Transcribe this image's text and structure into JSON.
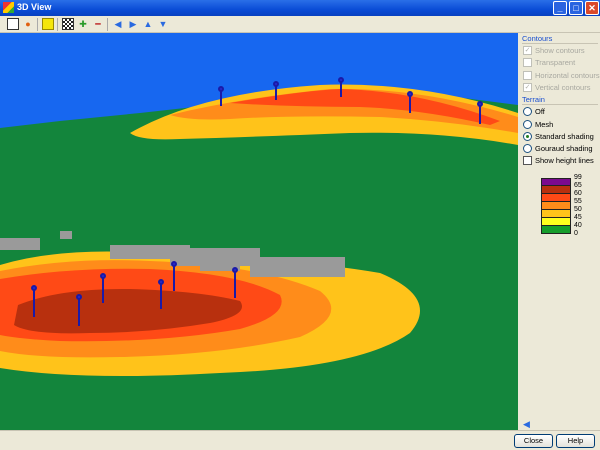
{
  "window": {
    "title": "3D View",
    "minimize": "_",
    "maximize": "□",
    "close": "✕"
  },
  "toolbar": {
    "icons": [
      "fit-view-icon",
      "render-icon",
      "highlight-icon",
      "grid-icon",
      "zoom-in-icon",
      "zoom-out-icon",
      "pan-left-icon",
      "pan-right-icon",
      "pan-up-icon",
      "pan-down-icon"
    ]
  },
  "contours": {
    "heading": "Contours",
    "show_contours": "Show contours",
    "transparent": "Transparent",
    "horizontal": "Horizontal contours",
    "vertical": "Vertical contours"
  },
  "terrain": {
    "heading": "Terrain",
    "off": "Off",
    "mesh": "Mesh",
    "standard": "Standard shading",
    "gouraud": "Gouraud shading",
    "height_lines": "Show height lines",
    "selected": "standard"
  },
  "legend": {
    "values": [
      "99",
      "65",
      "60",
      "55",
      "50",
      "45",
      "40",
      "0"
    ],
    "colors": [
      "#7b0a8e",
      "#b8300e",
      "#ff4a16",
      "#ff8c1a",
      "#ffc31a",
      "#ffff1e",
      "#169d2c"
    ]
  },
  "colors": {
    "sky": "#1767f0",
    "terrain": "#13853c"
  },
  "buttons": {
    "close": "Close",
    "help": "Help"
  },
  "check": "✓"
}
